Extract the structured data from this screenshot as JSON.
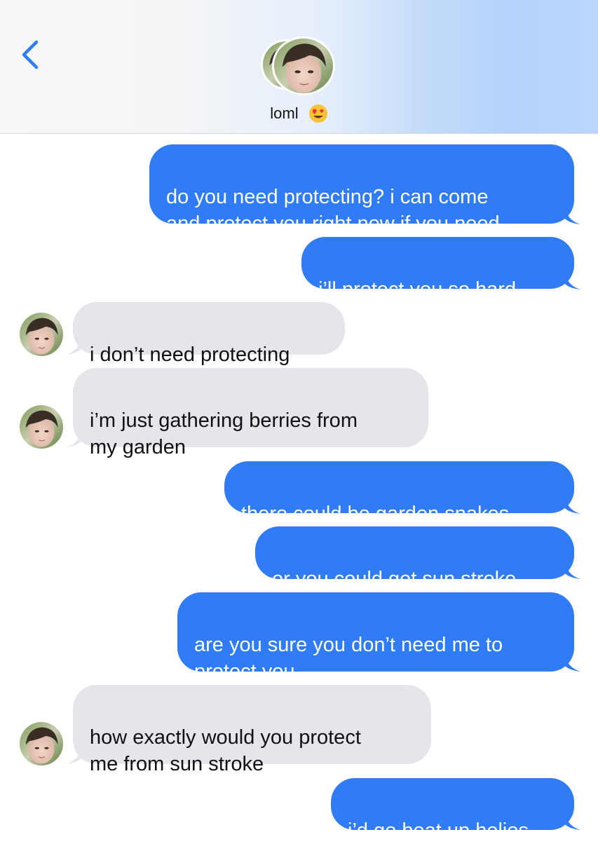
{
  "header": {
    "contact_name": "loml",
    "emoji_icon": "heart-eyes-emoji-icon",
    "back_icon": "chevron-left-icon"
  },
  "colors": {
    "sent_bubble": "#2f7cf6",
    "received_bubble": "#e6e5eb",
    "accent": "#2f7cf6"
  },
  "messages": [
    {
      "from": "me",
      "text": "do you need protecting? i can come\nand protect you right now if you need"
    },
    {
      "from": "me",
      "text": "i’ll protect you so hard"
    },
    {
      "from": "them",
      "text": "i don’t need protecting"
    },
    {
      "from": "them",
      "text": "i’m just gathering berries from\nmy garden"
    },
    {
      "from": "me",
      "text": "there could be garden snakes"
    },
    {
      "from": "me",
      "text": "or you could get sun stroke"
    },
    {
      "from": "me",
      "text": "are you sure you don’t need me to\nprotect you"
    },
    {
      "from": "them",
      "text": "how exactly would you protect\nme from sun stroke"
    },
    {
      "from": "me",
      "text": "i’d go beat up helios"
    }
  ]
}
